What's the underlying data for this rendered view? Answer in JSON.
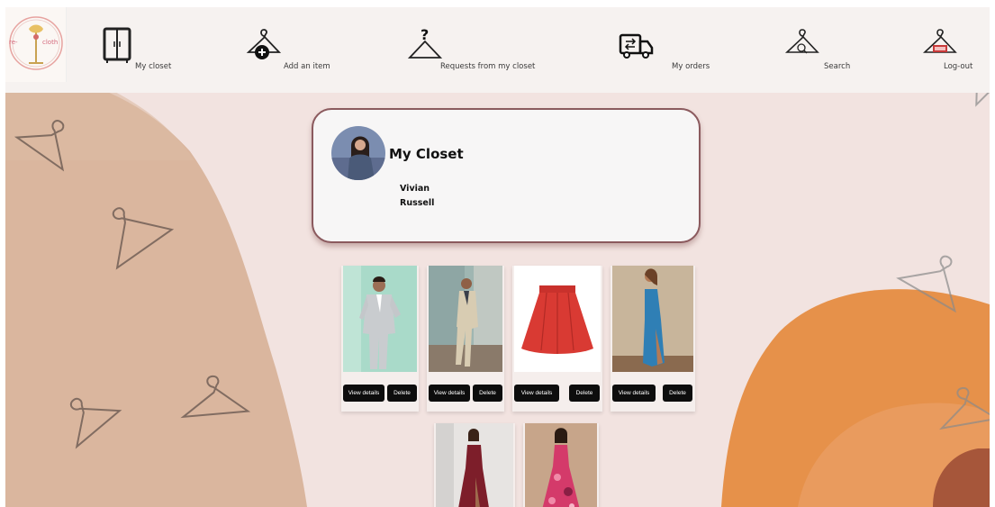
{
  "logo": {
    "text_left": "re-",
    "text_right": "cloth"
  },
  "nav": {
    "my_closet": "My closet",
    "add_item": "Add an item",
    "requests": "Requests from my closet",
    "my_orders": "My orders",
    "search": "Search",
    "logout": "Log-out"
  },
  "profile": {
    "title": "My Closet",
    "first_name": "Vivian",
    "last_name": "Russell"
  },
  "items": [
    {
      "name": "grey-suit",
      "view_label": "View details",
      "delete_label": "Delete"
    },
    {
      "name": "beige-suit",
      "view_label": "View details",
      "delete_label": "Delete"
    },
    {
      "name": "red-skirt",
      "view_label": "View details",
      "delete_label": "Delete"
    },
    {
      "name": "blue-dress",
      "view_label": "View details",
      "delete_label": "Delete"
    },
    {
      "name": "burgundy-gown"
    },
    {
      "name": "pink-floral-gown"
    }
  ],
  "colors": {
    "background": "#f2e3e0",
    "tan_shape": "#d8b39a",
    "orange_shape": "#e6914a",
    "card_border": "#8b5a5e",
    "button": "#0d0d0d"
  },
  "icons": [
    "wardrobe-icon",
    "hanger-plus-icon",
    "hanger-question-icon",
    "truck-icon",
    "hanger-search-icon",
    "hanger-exit-icon"
  ]
}
